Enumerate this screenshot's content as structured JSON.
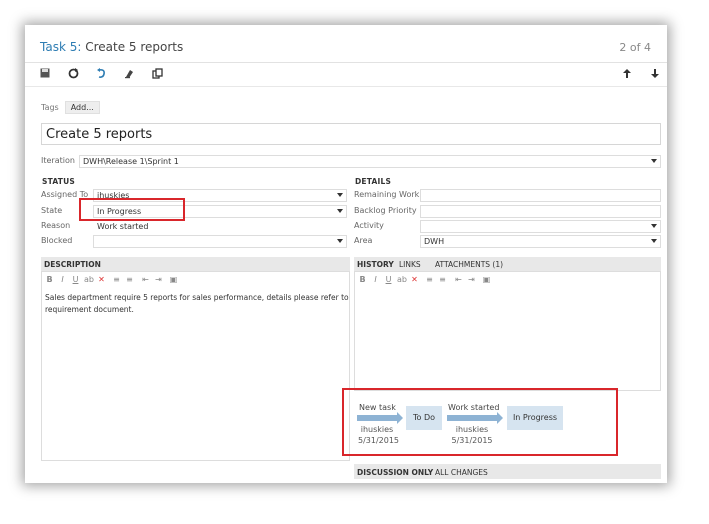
{
  "window": {
    "task_id": "Task 5:",
    "task_title": "Create 5 reports",
    "pager": "2 of 4"
  },
  "toolbar": {
    "icons": [
      "save-icon",
      "refresh-icon",
      "undo-icon",
      "clear-formatting-icon",
      "copy-icon",
      "arrow-up-icon",
      "arrow-down-icon"
    ]
  },
  "tags": {
    "label": "Tags",
    "add_label": "Add..."
  },
  "work_item": {
    "title": "Create 5 reports"
  },
  "iteration": {
    "label": "Iteration",
    "value": "DWH\\Release 1\\Sprint 1"
  },
  "status": {
    "heading": "STATUS",
    "assigned_to": {
      "label": "Assigned To",
      "value": "ihuskies"
    },
    "state": {
      "label": "State",
      "value": "In Progress"
    },
    "reason": {
      "label": "Reason",
      "value": "Work started"
    },
    "blocked": {
      "label": "Blocked",
      "value": ""
    }
  },
  "details": {
    "heading": "DETAILS",
    "remaining_work": {
      "label": "Remaining Work",
      "value": ""
    },
    "backlog_priority": {
      "label": "Backlog Priority",
      "value": ""
    },
    "activity": {
      "label": "Activity",
      "value": ""
    },
    "area": {
      "label": "Area",
      "value": "DWH"
    }
  },
  "description": {
    "heading": "DESCRIPTION",
    "text": "Sales department require 5 reports for sales performance, details please refer to requirement document."
  },
  "history_tabs": {
    "history": "HISTORY",
    "links": "LINKS",
    "attachments": "ATTACHMENTS (1)"
  },
  "history_flow": {
    "step1_label": "New task",
    "step1_user": "ihuskies",
    "step1_date": "5/31/2015",
    "node1": "To Do",
    "step2_label": "Work started",
    "step2_user": "ihuskies",
    "step2_date": "5/31/2015",
    "node2": "In Progress"
  },
  "discussion": {
    "discussion_only": "DISCUSSION ONLY",
    "all_changes": "ALL CHANGES"
  },
  "colors": {
    "accent": "#2e7db3",
    "highlight": "#d9262b",
    "node_bg": "#d6e4f0"
  }
}
